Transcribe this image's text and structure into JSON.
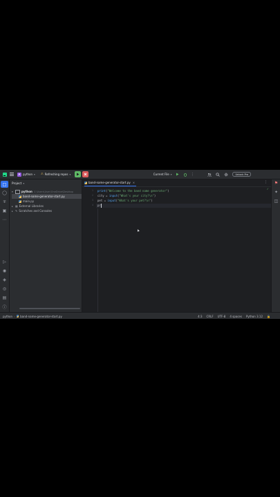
{
  "topbar": {
    "project_badge": "P",
    "project_name": "python",
    "branch": "Refreshing repos",
    "run_config": "Current File",
    "unlock_label": "Unlock Pro"
  },
  "project_panel": {
    "title": "Project",
    "root_name": "python",
    "root_path": "C:\\Users\\User\\OneDrive\\Desktop",
    "files": [
      "band-name-generator-start.py",
      "main.py"
    ],
    "external_libraries": "External Libraries",
    "scratches": "Scratches and Consoles"
  },
  "editor": {
    "tab_name": "band-name-generator-start.py",
    "line_numbers": [
      "1",
      "2",
      "3",
      "4"
    ],
    "lines": [
      [
        {
          "t": "print",
          "c": "#56a8f5"
        },
        {
          "t": "(",
          "c": "#bcbec4"
        },
        {
          "t": "\"Welcome to the band name generator\"",
          "c": "#6aab73"
        },
        {
          "t": ")",
          "c": "#bcbec4"
        }
      ],
      [
        {
          "t": "city = ",
          "c": "#bcbec4"
        },
        {
          "t": "input",
          "c": "#56a8f5"
        },
        {
          "t": "(",
          "c": "#bcbec4"
        },
        {
          "t": "\"What's your city?\\n\"",
          "c": "#6aab73"
        },
        {
          "t": ")",
          "c": "#bcbec4"
        }
      ],
      [
        {
          "t": "pet = ",
          "c": "#bcbec4"
        },
        {
          "t": "input",
          "c": "#56a8f5"
        },
        {
          "t": "(",
          "c": "#bcbec4"
        },
        {
          "t": "\"What's your pet?\\n\"",
          "c": "#6aab73"
        },
        {
          "t": ")",
          "c": "#bcbec4"
        }
      ],
      [
        {
          "t": "pr",
          "c": "#bcbec4"
        }
      ]
    ]
  },
  "statusbar": {
    "crumbs": [
      "python",
      "band-name-generator-start.py"
    ],
    "position": "4:3",
    "line_sep": "CRLF",
    "encoding": "UTF-8",
    "indent": "4 spaces",
    "interpreter": "Python 3.12"
  },
  "colors": {
    "accent": "#3574f0",
    "run_green": "#5fb865",
    "stop_red": "#db5c5c",
    "warning": "#f2c55c"
  }
}
